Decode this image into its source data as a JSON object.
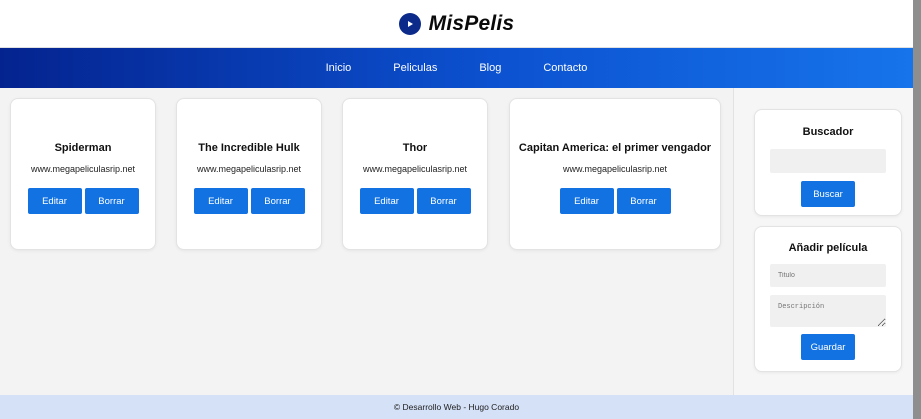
{
  "header": {
    "title": "MisPelis",
    "logo_icon": "play-icon"
  },
  "nav": {
    "items": [
      "Inicio",
      "Peliculas",
      "Blog",
      "Contacto"
    ]
  },
  "movies": [
    {
      "title": "Spiderman",
      "url": "www.megapeliculasrip.net",
      "edit_label": "Editar",
      "delete_label": "Borrar"
    },
    {
      "title": "The Incredible Hulk",
      "url": "www.megapeliculasrip.net",
      "edit_label": "Editar",
      "delete_label": "Borrar"
    },
    {
      "title": "Thor",
      "url": "www.megapeliculasrip.net",
      "edit_label": "Editar",
      "delete_label": "Borrar"
    },
    {
      "title": "Capitan America: el primer vengador",
      "url": "www.megapeliculasrip.net",
      "edit_label": "Editar",
      "delete_label": "Borrar"
    }
  ],
  "search": {
    "title": "Buscador",
    "value": "",
    "button_label": "Buscar"
  },
  "add_movie": {
    "title": "Añadir película",
    "title_placeholder": "Titulo",
    "description_placeholder": "Descripción",
    "button_label": "Guardar"
  },
  "footer": {
    "text": "© Desarrollo Web - Hugo Corado"
  },
  "colors": {
    "accent": "#1272e2",
    "nav_start": "#04238f",
    "nav_end": "#1774ea",
    "footer_bg": "#d5e1f7"
  }
}
